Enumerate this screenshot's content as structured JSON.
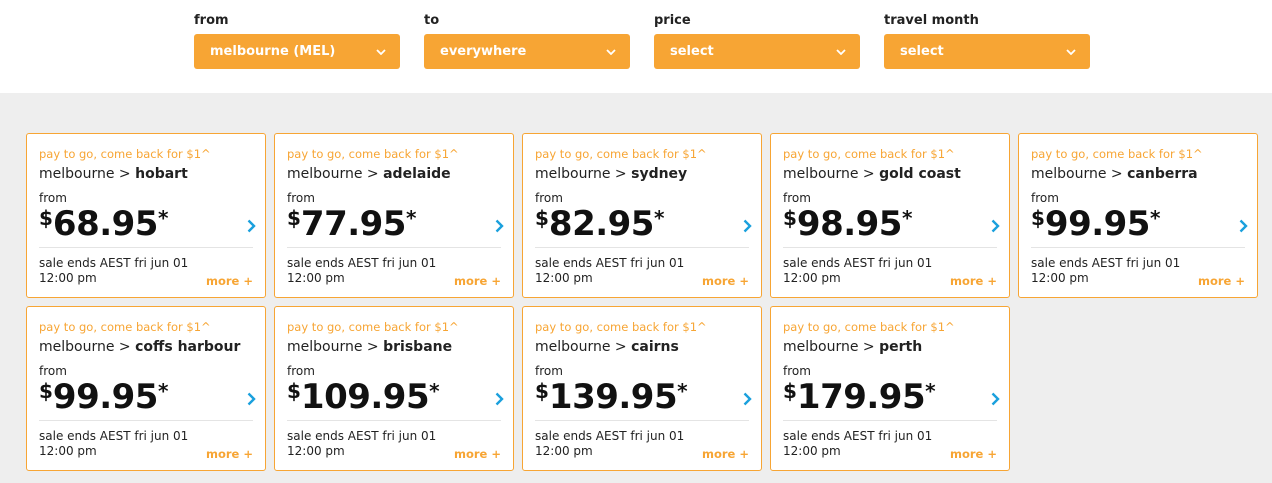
{
  "filters": [
    {
      "label": "from",
      "value": "melbourne (MEL)"
    },
    {
      "label": "to",
      "value": "everywhere"
    },
    {
      "label": "price",
      "value": "select"
    },
    {
      "label": "travel month",
      "value": "select"
    }
  ],
  "colors": {
    "accent": "#f7a534",
    "arrow": "#1aa0dd",
    "panel": "#eeeeee"
  },
  "icons": {
    "dropdown": "chevron-down-icon",
    "card": "chevron-right-icon"
  },
  "deals": [
    {
      "promo": "pay to go, come back for $1^",
      "origin": "melbourne",
      "sep": ">",
      "destination": "hobart",
      "from_label": "from",
      "currency": "$",
      "price": "68.95",
      "star": "*",
      "ends_line1": "sale ends AEST fri jun 01",
      "ends_line2": "12:00 pm",
      "more": "more +"
    },
    {
      "promo": "pay to go, come back for $1^",
      "origin": "melbourne",
      "sep": ">",
      "destination": "adelaide",
      "from_label": "from",
      "currency": "$",
      "price": "77.95",
      "star": "*",
      "ends_line1": "sale ends AEST fri jun 01",
      "ends_line2": "12:00 pm",
      "more": "more +"
    },
    {
      "promo": "pay to go, come back for $1^",
      "origin": "melbourne",
      "sep": ">",
      "destination": "sydney",
      "from_label": "from",
      "currency": "$",
      "price": "82.95",
      "star": "*",
      "ends_line1": "sale ends AEST fri jun 01",
      "ends_line2": "12:00 pm",
      "more": "more +"
    },
    {
      "promo": "pay to go, come back for $1^",
      "origin": "melbourne",
      "sep": ">",
      "destination": "gold coast",
      "from_label": "from",
      "currency": "$",
      "price": "98.95",
      "star": "*",
      "ends_line1": "sale ends AEST fri jun 01",
      "ends_line2": "12:00 pm",
      "more": "more +"
    },
    {
      "promo": "pay to go, come back for $1^",
      "origin": "melbourne",
      "sep": ">",
      "destination": "canberra",
      "from_label": "from",
      "currency": "$",
      "price": "99.95",
      "star": "*",
      "ends_line1": "sale ends AEST fri jun 01",
      "ends_line2": "12:00 pm",
      "more": "more +"
    },
    {
      "promo": "pay to go, come back for $1^",
      "origin": "melbourne",
      "sep": ">",
      "destination": "coffs harbour",
      "from_label": "from",
      "currency": "$",
      "price": "99.95",
      "star": "*",
      "ends_line1": "sale ends AEST fri jun 01",
      "ends_line2": "12:00 pm",
      "more": "more +"
    },
    {
      "promo": "pay to go, come back for $1^",
      "origin": "melbourne",
      "sep": ">",
      "destination": "brisbane",
      "from_label": "from",
      "currency": "$",
      "price": "109.95",
      "star": "*",
      "ends_line1": "sale ends AEST fri jun 01",
      "ends_line2": "12:00 pm",
      "more": "more +"
    },
    {
      "promo": "pay to go, come back for $1^",
      "origin": "melbourne",
      "sep": ">",
      "destination": "cairns",
      "from_label": "from",
      "currency": "$",
      "price": "139.95",
      "star": "*",
      "ends_line1": "sale ends AEST fri jun 01",
      "ends_line2": "12:00 pm",
      "more": "more +"
    },
    {
      "promo": "pay to go, come back for $1^",
      "origin": "melbourne",
      "sep": ">",
      "destination": "perth",
      "from_label": "from",
      "currency": "$",
      "price": "179.95",
      "star": "*",
      "ends_line1": "sale ends AEST fri jun 01",
      "ends_line2": "12:00 pm",
      "more": "more +"
    }
  ]
}
